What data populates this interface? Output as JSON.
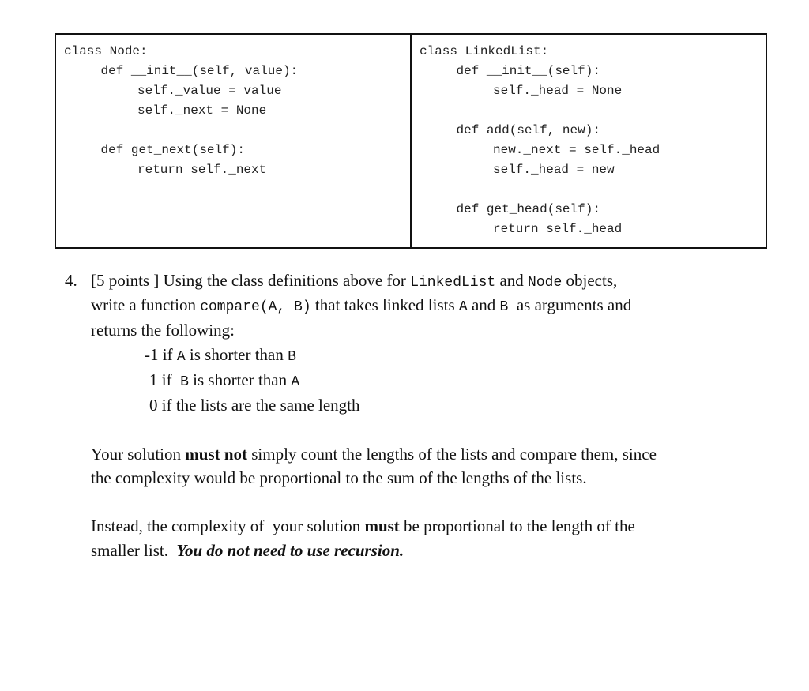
{
  "code": {
    "node": [
      {
        "indent": 0,
        "text": "class Node:"
      },
      {
        "indent": 1,
        "text": "def __init__(self, value):"
      },
      {
        "indent": 2,
        "text": "self._value = value"
      },
      {
        "indent": 2,
        "text": "self._next = None"
      },
      {
        "indent": 0,
        "text": ""
      },
      {
        "indent": 1,
        "text": "def get_next(self):"
      },
      {
        "indent": 2,
        "text": "return self._next"
      }
    ],
    "linkedlist": [
      {
        "indent": 0,
        "text": "class LinkedList:"
      },
      {
        "indent": 1,
        "text": "def __init__(self):"
      },
      {
        "indent": 2,
        "text": "self._head = None"
      },
      {
        "indent": 0,
        "text": ""
      },
      {
        "indent": 1,
        "text": "def add(self, new):"
      },
      {
        "indent": 2,
        "text": "new._next = self._head"
      },
      {
        "indent": 2,
        "text": "self._head = new"
      },
      {
        "indent": 0,
        "text": ""
      },
      {
        "indent": 1,
        "text": "def get_head(self):"
      },
      {
        "indent": 2,
        "text": "return self._head"
      }
    ]
  },
  "question": {
    "number": "4.",
    "points": "[5 points ]",
    "line1_a": " Using the class definitions above for ",
    "line1_code1": "LinkedList",
    "line1_b": " and ",
    "line1_code2": "Node",
    "line1_c": " objects,",
    "line2_a": "write a function ",
    "line2_code": "compare(A, B)",
    "line2_b": " that takes linked lists ",
    "line2_codeA": "A",
    "line2_c": " and ",
    "line2_codeB": "B",
    "line2_d": "  as arguments and",
    "line3": "returns the following:",
    "cases": [
      {
        "value": "-1",
        "pre": " if ",
        "x": "A",
        "mid": " is shorter than ",
        "y": "B"
      },
      {
        "value": "1",
        "pre": " if  ",
        "x": "B",
        "mid": " is shorter than ",
        "y": "A"
      },
      {
        "value": "0",
        "pre": " if the lists are the same length",
        "x": "",
        "mid": "",
        "y": ""
      }
    ],
    "para1_a": "Your solution ",
    "para1_bold": "must not",
    "para1_b": " simply count the lengths of the lists and compare them, since",
    "para1_line2": "the complexity would be proportional to the sum of the lengths of the lists.",
    "para2_a": "Instead, the complexity of  your solution ",
    "para2_bold": "must",
    "para2_b": " be proportional to the length of the",
    "para2_line2": "smaller list.  ",
    "para2_bolditalic": "You do not need to use recursion."
  }
}
